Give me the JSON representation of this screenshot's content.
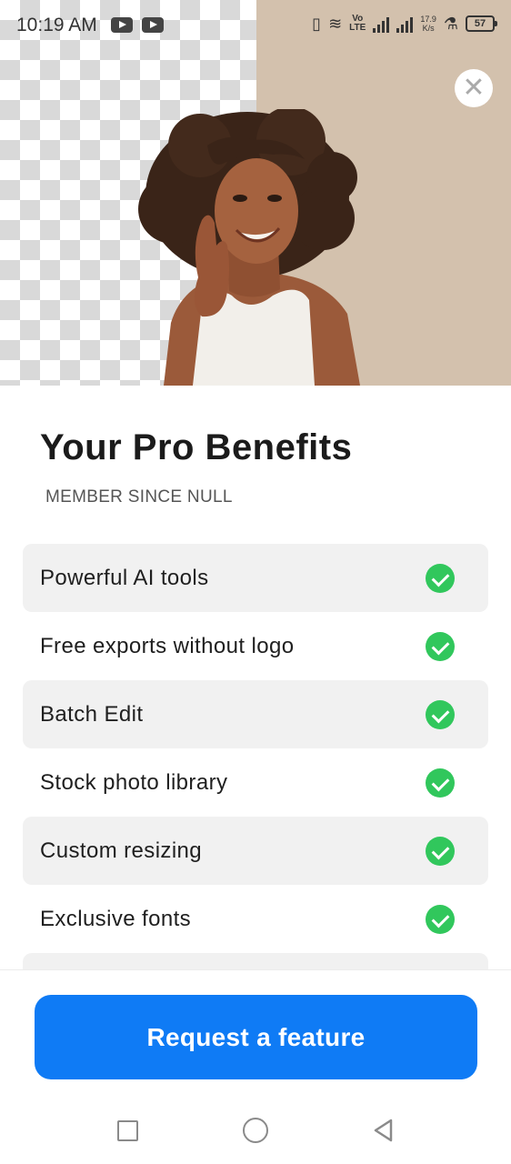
{
  "status_bar": {
    "time": "10:19 AM",
    "volte_line1": "Vo",
    "volte_line2": "LTE",
    "speed_value": "17.9",
    "speed_unit": "K/s",
    "battery": "57"
  },
  "header": {
    "close_icon": "close-icon"
  },
  "main": {
    "title": "Your Pro Benefits",
    "member_since": "MEMBER SINCE NULL",
    "benefits": [
      {
        "label": "Powerful AI tools",
        "icon": "check-circle-icon"
      },
      {
        "label": "Free exports without logo",
        "icon": "check-circle-icon"
      },
      {
        "label": "Batch Edit",
        "icon": "check-circle-icon"
      },
      {
        "label": "Stock photo library",
        "icon": "check-circle-icon"
      },
      {
        "label": "Custom resizing",
        "icon": "check-circle-icon"
      },
      {
        "label": "Exclusive fonts",
        "icon": "check-circle-icon"
      }
    ]
  },
  "footer": {
    "request_button_label": "Request a feature"
  },
  "nav_bar": {
    "recents_icon": "square-icon",
    "home_icon": "circle-icon",
    "back_icon": "triangle-back-icon"
  },
  "colors": {
    "accent": "#0f7bf5",
    "check": "#31c75c",
    "hero_background": "#d3c1ad",
    "row_shade": "#f1f1f1"
  }
}
